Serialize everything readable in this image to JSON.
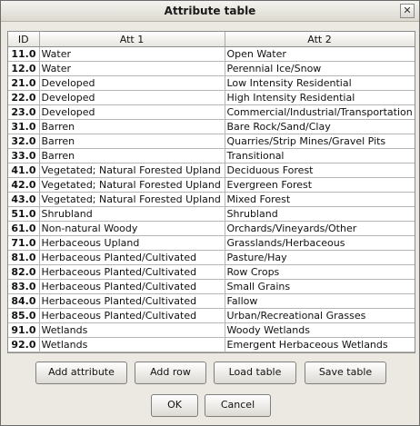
{
  "window": {
    "title": "Attribute table",
    "close_glyph": "✕"
  },
  "table": {
    "headers": [
      "ID",
      "Att 1",
      "Att 2"
    ],
    "rows": [
      [
        "11.0",
        "Water",
        "Open Water"
      ],
      [
        "12.0",
        "Water",
        "Perennial Ice/Snow"
      ],
      [
        "21.0",
        "Developed",
        "Low Intensity Residential"
      ],
      [
        "22.0",
        "Developed",
        "High Intensity Residential"
      ],
      [
        "23.0",
        "Developed",
        "Commercial/Industrial/Transportation"
      ],
      [
        "31.0",
        "Barren",
        "Bare Rock/Sand/Clay"
      ],
      [
        "32.0",
        "Barren",
        "Quarries/Strip Mines/Gravel Pits"
      ],
      [
        "33.0",
        "Barren",
        "Transitional"
      ],
      [
        "41.0",
        "Vegetated; Natural Forested Upland",
        "Deciduous Forest"
      ],
      [
        "42.0",
        "Vegetated; Natural Forested Upland",
        "Evergreen Forest"
      ],
      [
        "43.0",
        "Vegetated; Natural Forested Upland",
        "Mixed Forest"
      ],
      [
        "51.0",
        "Shrubland",
        "Shrubland"
      ],
      [
        "61.0",
        "Non-natural Woody",
        "Orchards/Vineyards/Other"
      ],
      [
        "71.0",
        "Herbaceous Upland",
        "Grasslands/Herbaceous"
      ],
      [
        "81.0",
        "Herbaceous Planted/Cultivated",
        "Pasture/Hay"
      ],
      [
        "82.0",
        "Herbaceous Planted/Cultivated",
        "Row Crops"
      ],
      [
        "83.0",
        "Herbaceous Planted/Cultivated",
        "Small Grains"
      ],
      [
        "84.0",
        "Herbaceous Planted/Cultivated",
        "Fallow"
      ],
      [
        "85.0",
        "Herbaceous Planted/Cultivated",
        "Urban/Recreational Grasses"
      ],
      [
        "91.0",
        "Wetlands",
        "Woody Wetlands"
      ],
      [
        "92.0",
        "Wetlands",
        "Emergent Herbaceous Wetlands"
      ]
    ]
  },
  "buttons": {
    "add_attribute": "Add attribute",
    "add_row": "Add row",
    "load_table": "Load table",
    "save_table": "Save table",
    "ok": "OK",
    "cancel": "Cancel"
  }
}
